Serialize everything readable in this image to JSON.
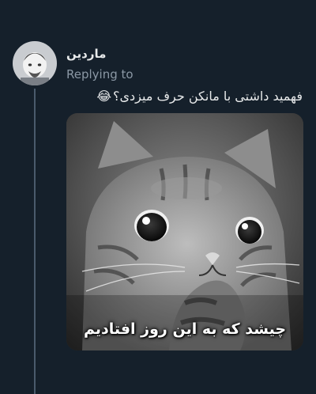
{
  "tweet": {
    "author_name": "ماردین",
    "replying_label": "Replying to",
    "text": "فهمید داشتی با مانکن حرف میزدی؟",
    "text_emoji": "😂"
  },
  "media": {
    "caption": "چیشد که به این روز افتادیم"
  },
  "colors": {
    "background": "#15202b",
    "text_primary": "#e7e9ea",
    "text_secondary": "#8b98a5",
    "thread_line": "#4a5b6c"
  }
}
